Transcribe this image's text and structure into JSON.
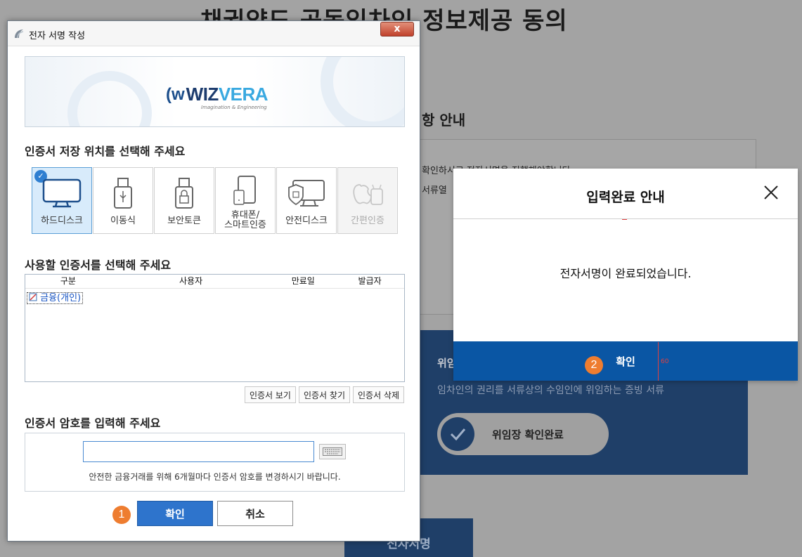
{
  "background": {
    "page_title": "채권양도 공동임차인 정보제공 동의",
    "section_title": "항 안내",
    "notice_line1": "확인하시고 전자서명을 진행해야합니다.",
    "notice_line2": "서류열",
    "delegation_heading": "위임",
    "delegation_desc": "임차인의 권리를 서류상의 수임인에 위임하는 증빙 서류",
    "delegation_status": "위임장 확인완료",
    "sign_button": "전자서명"
  },
  "modal": {
    "title": "입력완료 안내",
    "message": "전자서명이 완료되었습니다.",
    "ok_label": "확인",
    "marker": "2",
    "guide_value": "60"
  },
  "dialog": {
    "window_title": "전자 서명 작성",
    "close_label": "x",
    "logo_text_1": "WIZ",
    "logo_text_2": "VERA",
    "logo_tagline": "Imagination & Engineering",
    "storage_title": "인증서 저장 위치를 선택해 주세요",
    "storage_options": [
      {
        "label": "하드디스크",
        "selected": true,
        "disabled": false
      },
      {
        "label": "이동식",
        "selected": false,
        "disabled": false
      },
      {
        "label": "보안토큰",
        "selected": false,
        "disabled": false
      },
      {
        "label": "휴대폰/\n스마트인증",
        "selected": false,
        "disabled": false
      },
      {
        "label": "안전디스크",
        "selected": false,
        "disabled": false
      },
      {
        "label": "간편인증",
        "selected": false,
        "disabled": true
      }
    ],
    "cert_title": "사용할 인증서를 선택해 주세요",
    "cert_columns": [
      "구분",
      "사용자",
      "만료일",
      "발급자"
    ],
    "cert_rows": [
      {
        "type": "금융(개인)",
        "user": "",
        "expiry": "",
        "issuer": ""
      }
    ],
    "cert_buttons": {
      "view": "인증서 보기",
      "find": "인증서 찾기",
      "delete": "인증서 삭제"
    },
    "password_title": "인증서 암호를 입력해 주세요",
    "password_value": "",
    "password_note": "안전한 금융거래를 위해 6개월마다 인증서 암호를 변경하시기 바랍니다.",
    "ok_label": "확인",
    "cancel_label": "취소",
    "marker": "1"
  },
  "colors": {
    "modal_accent": "#0a56a4",
    "dialog_ok": "#2e74cc",
    "marker": "#ee7d30",
    "bg_blue": "#1f3f68"
  }
}
